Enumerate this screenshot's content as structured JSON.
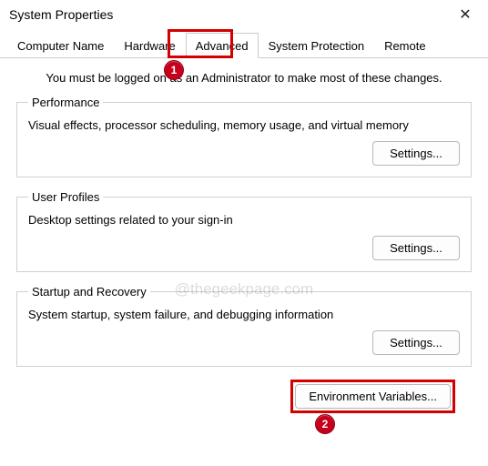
{
  "window": {
    "title": "System Properties",
    "close_glyph": "✕"
  },
  "tabs": {
    "computer_name": "Computer Name",
    "hardware": "Hardware",
    "advanced": "Advanced",
    "system_protection": "System Protection",
    "remote": "Remote",
    "active": "advanced"
  },
  "instruction": "You must be logged on as an Administrator to make most of these changes.",
  "groups": {
    "performance": {
      "legend": "Performance",
      "desc": "Visual effects, processor scheduling, memory usage, and virtual memory",
      "button": "Settings..."
    },
    "user_profiles": {
      "legend": "User Profiles",
      "desc": "Desktop settings related to your sign-in",
      "button": "Settings..."
    },
    "startup": {
      "legend": "Startup and Recovery",
      "desc": "System startup, system failure, and debugging information",
      "button": "Settings..."
    }
  },
  "env_button": "Environment Variables...",
  "watermark": "@thegeekpage.com",
  "annotations": {
    "marker1": "1",
    "marker2": "2"
  }
}
